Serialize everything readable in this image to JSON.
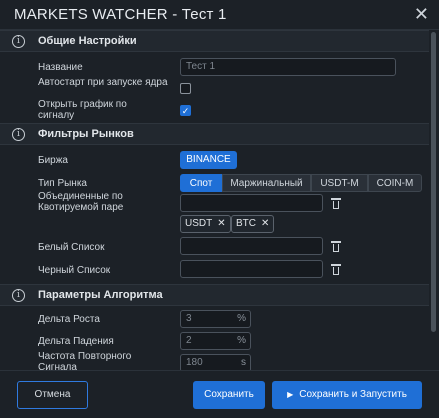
{
  "window": {
    "title": "MARKETS WATCHER - Тест 1"
  },
  "sections": {
    "general": {
      "title": "Общие Настройки",
      "name_label": "Название",
      "name_placeholder": "Тест 1",
      "autostart_label": "Автостарт при запуске ядра",
      "autostart_checked": false,
      "open_chart_label": "Открыть график по сигналу",
      "open_chart_checked": true
    },
    "filters": {
      "title": "Фильтры Рынков",
      "exchange_label": "Биржа",
      "exchange_value": "BINANCE",
      "market_type_label": "Тип Рынка",
      "market_types": [
        "Спот",
        "Маржинальный",
        "USDT-M",
        "COIN-M"
      ],
      "market_type_active": "Спот",
      "quote_label": "Объединенные по Квотируемой паре",
      "quote_tags": [
        "USDT",
        "BTC"
      ],
      "whitelist_label": "Белый Список",
      "blacklist_label": "Черный Список"
    },
    "algorithm": {
      "title": "Параметры Алгоритма",
      "growth_label": "Дельта Роста",
      "growth_value": "3",
      "growth_unit": "%",
      "fall_label": "Дельта Падения",
      "fall_value": "2",
      "fall_unit": "%",
      "repeat_label": "Частота Повторного Сигнала",
      "repeat_value": "180",
      "repeat_unit": "s"
    }
  },
  "footer": {
    "cancel_label": "Отмена",
    "save_label": "Сохранить",
    "save_run_label": "Сохранить и Запустить"
  },
  "colors": {
    "accent": "#1f6fd6",
    "background": "#1c2127"
  }
}
